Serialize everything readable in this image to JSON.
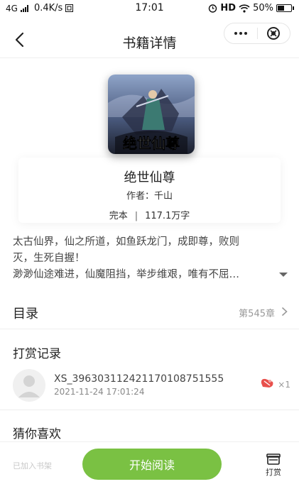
{
  "status_bar": {
    "network": "4G",
    "speed": "0.4K/s",
    "time": "17:01",
    "hd": "HD",
    "battery": "50%",
    "battery_level": 0.5
  },
  "header": {
    "title": "书籍详情",
    "more_icon": "ellipsis-icon",
    "close_icon": "close-circle-icon"
  },
  "book": {
    "cover_text": "绝世仙尊",
    "name": "绝世仙尊",
    "author_label": "作者：",
    "author": "千山",
    "status": "完本",
    "separator": "|",
    "word_count": "117.1万字",
    "description_lines": [
      "太古仙界，仙之所道，如鱼跃龙门，成即尊，败则",
      "灭，生死自握！",
      "渺渺仙途难进，仙魔阻挡，举步维艰，唯有不屈…"
    ]
  },
  "catalog": {
    "label": "目录",
    "latest_chapter": "第545章"
  },
  "rewards": {
    "title": "打赏记录",
    "items": [
      {
        "user": "XS_396303112421170108751555",
        "time": "2021-11-24 17:01:24",
        "count": "×1"
      }
    ]
  },
  "recommend": {
    "title": "猜你喜欢"
  },
  "bottom": {
    "shelf_status": "已加入书架",
    "read_button": "开始阅读",
    "tip_label": "打赏"
  },
  "colors": {
    "accent_green": "#7ac143",
    "gift_red": "#e8504c"
  }
}
